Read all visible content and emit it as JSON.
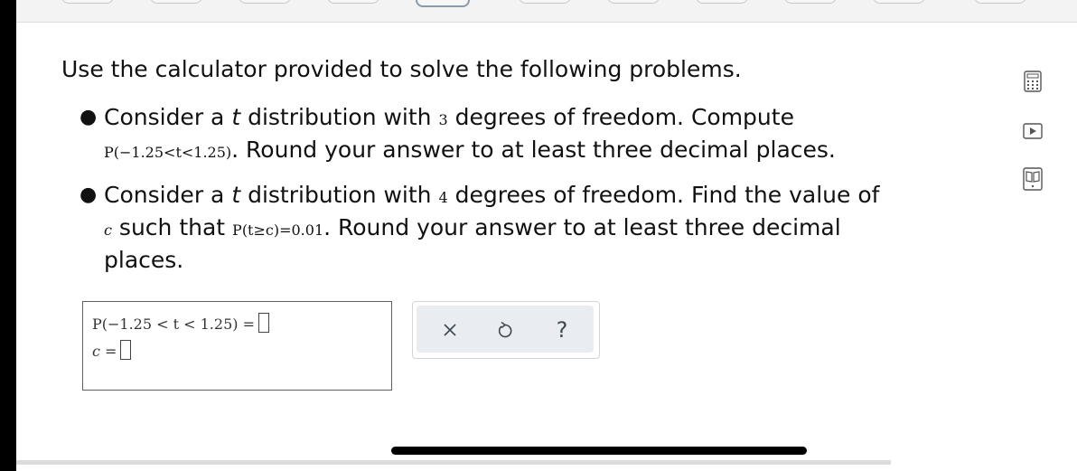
{
  "intro": "Use the calculator provided to solve the following problems.",
  "item1": {
    "line1_prefix": "Consider a ",
    "t_symbol": "t",
    "line1_mid": " distribution with ",
    "df": "3",
    "line1_suffix": " degrees of freedom. Compute",
    "math": "P(−1.25<t<1.25)",
    "line2_suffix": ". Round your answer to at least three decimal places."
  },
  "item2": {
    "line1_prefix": "Consider a ",
    "t_symbol": "t",
    "line1_mid": " distribution with ",
    "df": "4",
    "line1_suffix": " degrees of freedom. Find the value of",
    "c_symbol": "c",
    "line2_mid": " such that ",
    "math": "P(t≥c)=0.01",
    "line2_suffix": ". Round your answer to at least three decimal",
    "line3": "places."
  },
  "answers": {
    "row1_label": "P(−1.25 < t < 1.25) =",
    "row1_value": "",
    "row2_label": "c =",
    "row2_value": ""
  },
  "toolbar": {
    "clear_glyph": "✕",
    "undo_glyph": "↺",
    "help_glyph": "?"
  },
  "side_icons": [
    "calculator-icon",
    "video-play-icon",
    "textbook-icon"
  ],
  "colors": {
    "toolbar_bg": "#e9edf1",
    "icon_color": "#3c4752"
  }
}
